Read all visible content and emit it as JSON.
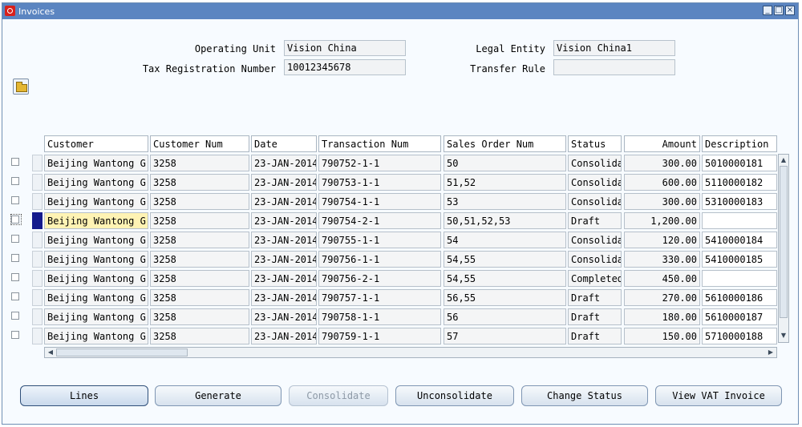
{
  "window": {
    "title": "Invoices"
  },
  "header": {
    "operating_unit_label": "Operating Unit",
    "operating_unit_value": "Vision China",
    "tax_reg_label": "Tax Registration Number",
    "tax_reg_value": "10012345678",
    "legal_entity_label": "Legal Entity",
    "legal_entity_value": "Vision China1",
    "transfer_rule_label": "Transfer Rule",
    "transfer_rule_value": ""
  },
  "table": {
    "columns": [
      "Customer",
      "Customer Num",
      "Date",
      "Transaction Num",
      "Sales Order Num",
      "Status",
      "Amount",
      "Description"
    ],
    "rows": [
      {
        "customer": "Beijing Wantong Gr",
        "customer_num": "3258",
        "date": "23-JAN-2014",
        "transaction_num": "790752-1-1",
        "sales_order_num": "50",
        "status": "Consolida",
        "amount": "300.00",
        "description": "5010000181"
      },
      {
        "customer": "Beijing Wantong Gr",
        "customer_num": "3258",
        "date": "23-JAN-2014",
        "transaction_num": "790753-1-1",
        "sales_order_num": "51,52",
        "status": "Consolida",
        "amount": "600.00",
        "description": "5110000182"
      },
      {
        "customer": "Beijing Wantong Gr",
        "customer_num": "3258",
        "date": "23-JAN-2014",
        "transaction_num": "790754-1-1",
        "sales_order_num": "53",
        "status": "Consolida",
        "amount": "300.00",
        "description": "5310000183"
      },
      {
        "customer": "Beijing Wantong Gr",
        "customer_num": "3258",
        "date": "23-JAN-2014",
        "transaction_num": "790754-2-1",
        "sales_order_num": "50,51,52,53",
        "status": "Draft",
        "amount": "1,200.00",
        "description": ""
      },
      {
        "customer": "Beijing Wantong Gr",
        "customer_num": "3258",
        "date": "23-JAN-2014",
        "transaction_num": "790755-1-1",
        "sales_order_num": "54",
        "status": "Consolida",
        "amount": "120.00",
        "description": "5410000184"
      },
      {
        "customer": "Beijing Wantong Gr",
        "customer_num": "3258",
        "date": "23-JAN-2014",
        "transaction_num": "790756-1-1",
        "sales_order_num": "54,55",
        "status": "Consolida",
        "amount": "330.00",
        "description": "5410000185"
      },
      {
        "customer": "Beijing Wantong Gr",
        "customer_num": "3258",
        "date": "23-JAN-2014",
        "transaction_num": "790756-2-1",
        "sales_order_num": "54,55",
        "status": "Completed",
        "amount": "450.00",
        "description": ""
      },
      {
        "customer": "Beijing Wantong Gr",
        "customer_num": "3258",
        "date": "23-JAN-2014",
        "transaction_num": "790757-1-1",
        "sales_order_num": "56,55",
        "status": "Draft",
        "amount": "270.00",
        "description": "5610000186"
      },
      {
        "customer": "Beijing Wantong Gr",
        "customer_num": "3258",
        "date": "23-JAN-2014",
        "transaction_num": "790758-1-1",
        "sales_order_num": "56",
        "status": "Draft",
        "amount": "180.00",
        "description": "5610000187"
      },
      {
        "customer": "Beijing Wantong Gr",
        "customer_num": "3258",
        "date": "23-JAN-2014",
        "transaction_num": "790759-1-1",
        "sales_order_num": "57",
        "status": "Draft",
        "amount": "150.00",
        "description": "5710000188"
      }
    ]
  },
  "buttons": {
    "lines": "Lines",
    "generate": "Generate",
    "consolidate": "Consolidate",
    "unconsolidate": "Unconsolidate",
    "change_status": "Change Status",
    "view_vat_invoice": "View VAT Invoice"
  },
  "icons": {
    "app": "oracle-logo-icon",
    "folder": "folder-open-icon",
    "minimize": "minimize-icon",
    "maximize": "maximize-icon",
    "close": "close-icon"
  },
  "colors": {
    "titlebar": "#5b85c1",
    "selected_row_indicator": "#141a8c",
    "selected_cell": "#fff3b4"
  }
}
